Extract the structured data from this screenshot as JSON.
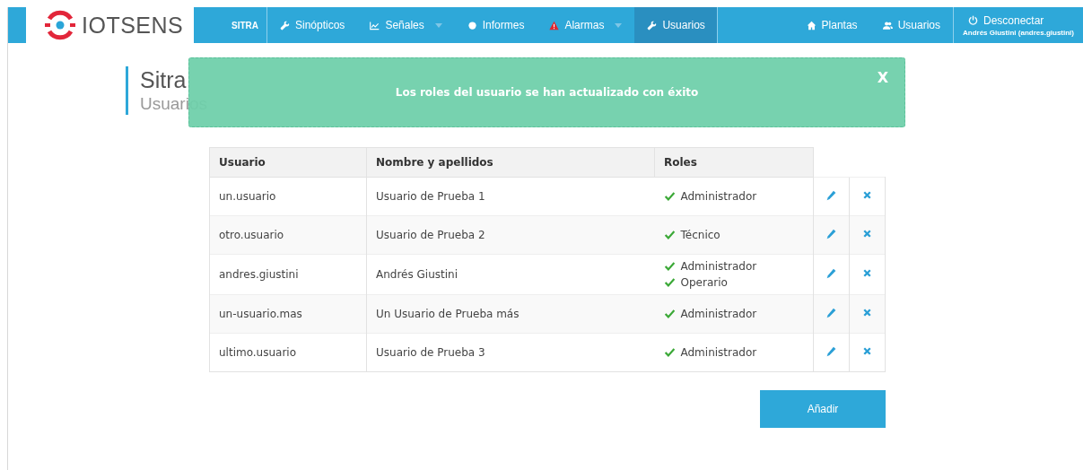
{
  "navbar": {
    "logo": "IOTSENS",
    "brand": "SITRA",
    "items": [
      {
        "label": "Sinópticos",
        "kind": "wrench",
        "dropdown": false,
        "selected": false
      },
      {
        "label": "Señales",
        "kind": "chart",
        "dropdown": true,
        "selected": false
      },
      {
        "label": "Informes",
        "kind": "dot",
        "dropdown": false,
        "selected": false
      },
      {
        "label": "Alarmas",
        "kind": "warning",
        "dropdown": true,
        "selected": false
      },
      {
        "label": "Usuarios",
        "kind": "wrench",
        "dropdown": false,
        "selected": true
      }
    ],
    "right_items": [
      {
        "label": "Plantas",
        "kind": "home"
      },
      {
        "label": "Usuarios",
        "kind": "users"
      }
    ],
    "session": {
      "label": "Desconectar",
      "user": "Andrés Giustini (andres.giustini)"
    }
  },
  "heading": {
    "title": "Sitra",
    "subtitle": "Usuarios"
  },
  "alert": {
    "message": "Los roles del usuario se han actualizado con éxito",
    "close": "X"
  },
  "table": {
    "columns": [
      "Usuario",
      "Nombre y apellidos",
      "Roles"
    ],
    "rows": [
      {
        "user": "un.usuario",
        "name": "Usuario de Prueba 1",
        "roles": [
          "Administrador"
        ]
      },
      {
        "user": "otro.usuario",
        "name": "Usuario de Prueba 2",
        "roles": [
          "Técnico"
        ]
      },
      {
        "user": "andres.giustini",
        "name": "Andrés Giustini",
        "roles": [
          "Administrador",
          "Operario"
        ]
      },
      {
        "user": "un-usuario.mas",
        "name": "Un Usuario de Prueba más",
        "roles": [
          "Administrador"
        ]
      },
      {
        "user": "ultimo.usuario",
        "name": "Usuario de Prueba 3",
        "roles": [
          "Administrador"
        ]
      }
    ]
  },
  "add_button": "Añadir"
}
